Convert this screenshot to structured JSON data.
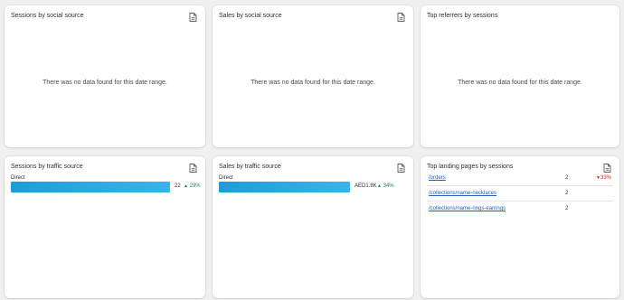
{
  "colors": {
    "bar": "#1f9cd6",
    "positive": "#1a7f4b",
    "negative": "#c4260f",
    "link": "#1f5fbf"
  },
  "cards": {
    "sessions_social": {
      "title": "Sessions by social source",
      "empty": "There was no data found for this date range."
    },
    "sales_social": {
      "title": "Sales by social source",
      "empty": "There was no data found for this date range."
    },
    "top_referrers": {
      "title": "Top referrers by sessions",
      "empty": "There was no data found for this date range."
    },
    "sessions_traffic": {
      "title": "Sessions by traffic source",
      "row": {
        "label": "Direct",
        "value": "22",
        "change": "29%",
        "fraction": 1.0
      }
    },
    "sales_traffic": {
      "title": "Sales by traffic source",
      "row": {
        "label": "Direct",
        "value": "AED1.8K",
        "change": "34%",
        "fraction": 1.0
      }
    },
    "landing_pages": {
      "title": "Top landing pages by sessions",
      "rows": [
        {
          "path": "/orders",
          "count": "2",
          "change": "33%"
        },
        {
          "path": "/collections/name-necklaces",
          "count": "2",
          "change": ""
        },
        {
          "path": "/collections/name-rings-earrings",
          "count": "2",
          "change": ""
        }
      ]
    }
  },
  "icons": {
    "export": "export-icon"
  }
}
